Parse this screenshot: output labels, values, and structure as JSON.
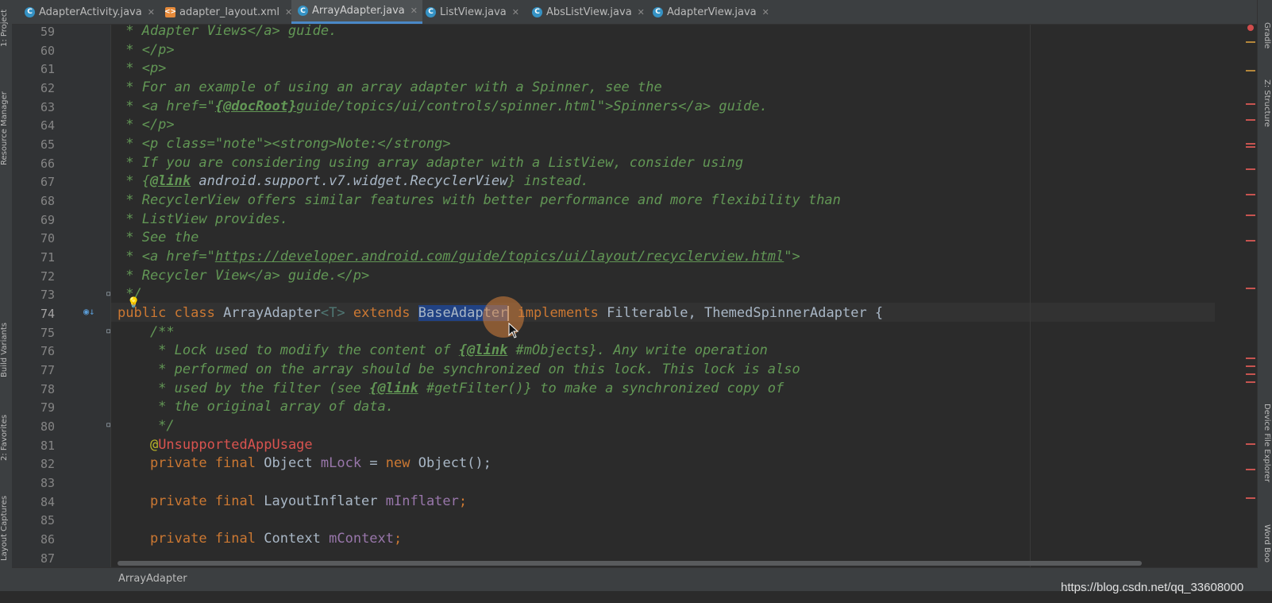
{
  "tabs": [
    {
      "label": "AdapterActivity.java",
      "icon": "C"
    },
    {
      "label": "adapter_layout.xml",
      "icon": "xml"
    },
    {
      "label": "ArrayAdapter.java",
      "icon": "C",
      "active": true
    },
    {
      "label": "ListView.java",
      "icon": "C"
    },
    {
      "label": "AbsListView.java",
      "icon": "C"
    },
    {
      "label": "AdapterView.java",
      "icon": "C"
    }
  ],
  "left_tools": [
    "1: Project",
    "Resource Manager",
    "Build Variants",
    "2: Favorites",
    "Layout Captures"
  ],
  "right_tools": [
    "Gradle",
    "Z: Structure",
    "Device File Explorer",
    "Word Boo"
  ],
  "line_numbers": [
    "59",
    "60",
    "61",
    "62",
    "63",
    "64",
    "65",
    "66",
    "67",
    "68",
    "69",
    "70",
    "71",
    "72",
    "73",
    "74",
    "75",
    "76",
    "77",
    "78",
    "79",
    "80",
    "81",
    "82",
    "83",
    "84",
    "85",
    "86",
    "87"
  ],
  "code": {
    "l59a": " * Adapter Views</a> guide.",
    "l60a": " * </p>",
    "l61a": " * <p>",
    "l62a": " * For an example of using an array adapter with a Spinner, see the",
    "l63a": " * <a href=\"",
    "l63b": "{@docRoot}",
    "l63c": "guide/topics/ui/controls/spinner.html\">Spinners</a> guide.",
    "l64a": " * </p>",
    "l65a": " * <p class=\"note\"><strong>Note:</strong>",
    "l66a": " * If you are considering using array adapter with a ListView, consider using",
    "l67a": " * {",
    "l67b": "@link",
    "l67c": " android.support.v7.widget.RecyclerView",
    "l67d": "} instead.",
    "l68a": " * RecyclerView offers similar features with better performance and more flexibility than",
    "l69a": " * ListView provides.",
    "l70a": " * See the",
    "l71a": " * <a href=\"",
    "l71b": "https://developer.android.com/guide/topics/ui/layout/recyclerview.html",
    "l71c": "\">",
    "l72a": " * Recycler View</a> guide.</p>",
    "l73a": " */",
    "l74_public": "public class",
    "l74_name": " ArrayAdapter",
    "l74_gen": "<T>",
    "l74_extends": " extends ",
    "l74_base": "BaseAdapter",
    "l74_impl": " implements",
    "l74_rest": " Filterable, ThemedSpinnerAdapter {",
    "l75a": "    /**",
    "l76a": "     * Lock used to modify the content of ",
    "l76b": "{@link",
    "l76c": " #mObjects}",
    "l76d": ". Any write operation",
    "l77a": "     * performed on the array should be synchronized on this lock. This lock is also",
    "l78a": "     * used by the filter (see ",
    "l78b": "{@link",
    "l78c": " #getFilter()}",
    "l78d": " to make a synchronized copy of",
    "l79a": "     * the original array of data.",
    "l80a": "     */",
    "l81a": "    @",
    "l81b": "UnsupportedAppUsage",
    "l82a": "    private final",
    "l82b": " Object ",
    "l82c": "mLock",
    "l82d": " = ",
    "l82e": "new",
    "l82f": " Object();",
    "l84a": "    private final",
    "l84b": " LayoutInflater ",
    "l84c": "mInflater",
    "l84d": ";",
    "l86a": "    private final",
    "l86b": " Context ",
    "l86c": "mContext",
    "l86d": ";"
  },
  "breadcrumb": "ArrayAdapter",
  "watermark": "https://blog.csdn.net/qq_33608000",
  "colors": {
    "keyword": "#cc7832",
    "doc": "#629755",
    "field": "#9876aa",
    "selection": "#214283",
    "annotation": "#bbb529"
  }
}
